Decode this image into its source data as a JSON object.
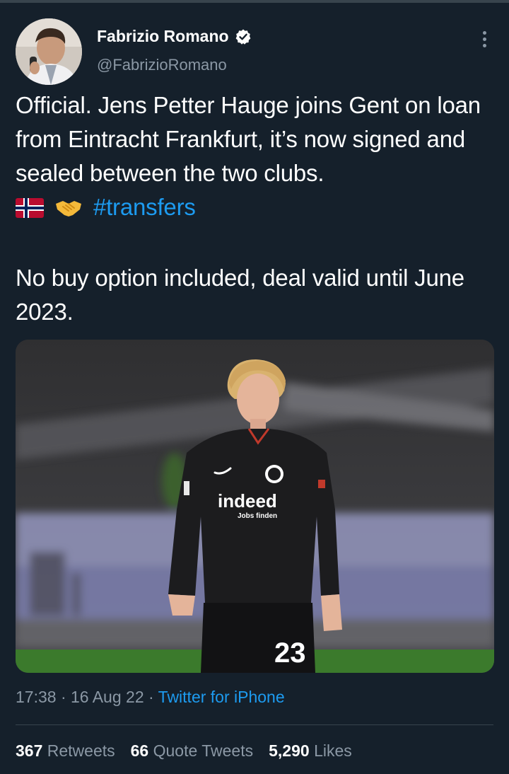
{
  "author": {
    "name": "Fabrizio Romano",
    "handle": "@FabrizioRomano",
    "verified": true,
    "verified_color": "#ffffff"
  },
  "tweet": {
    "line1": "Official. Jens Petter Hauge joins Gent on loan from Eintracht Frankfurt, it’s now signed and sealed between the two clubs.",
    "emojis": [
      "norway-flag-icon",
      "handshake-icon"
    ],
    "hashtag": "#transfers",
    "line2": "No buy option included, deal valid until June 2023."
  },
  "media": {
    "shirt_sponsor": "indeed",
    "shirt_sponsor_sub": "Jobs finden",
    "shirt_number": "23"
  },
  "meta": {
    "time": "17:38",
    "date": "16 Aug 22",
    "source": "Twitter for iPhone",
    "separator": "·"
  },
  "stats": {
    "retweets_count": "367",
    "retweets_label": "Retweets",
    "quotes_count": "66",
    "quotes_label": "Quote Tweets",
    "likes_count": "5,290",
    "likes_label": "Likes"
  },
  "colors": {
    "background": "#15202b",
    "text": "#ffffff",
    "secondary": "#8b98a5",
    "link": "#1d9bf0",
    "divider": "#38444d"
  }
}
